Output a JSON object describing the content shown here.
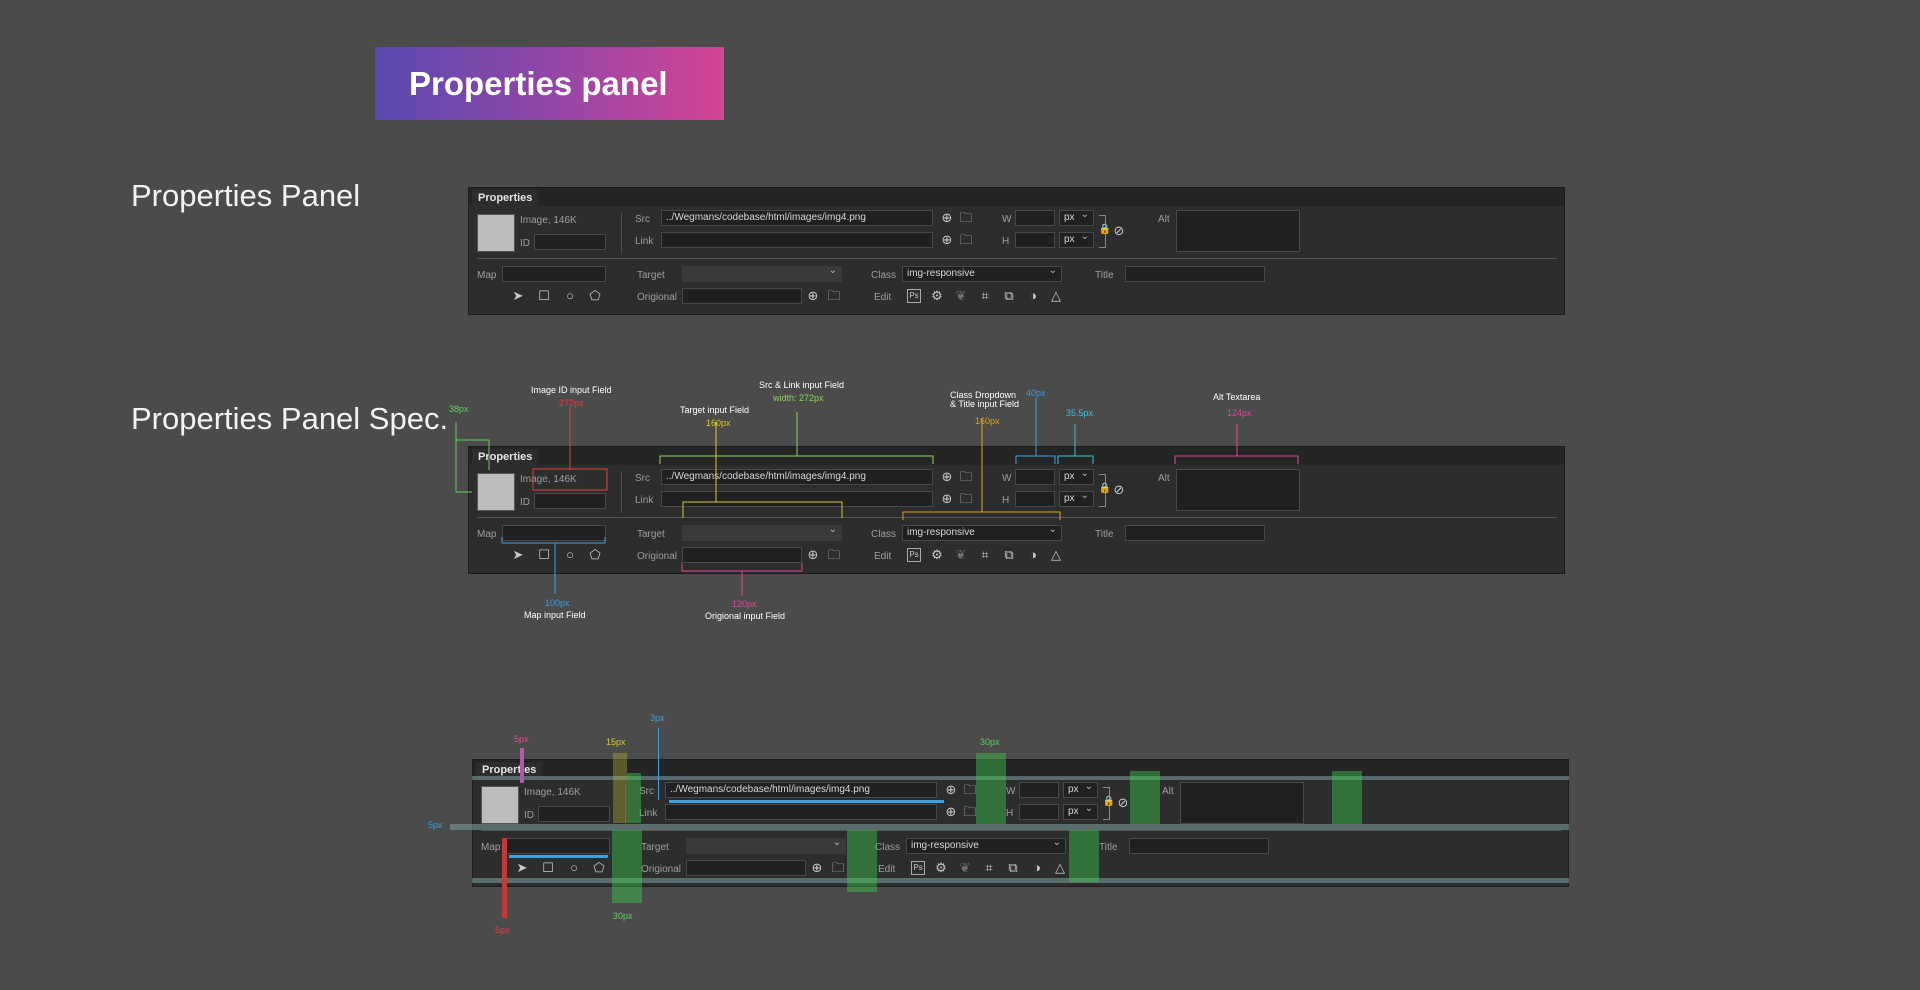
{
  "banner": {
    "title": "Properties panel"
  },
  "sections": {
    "panel": "Properties Panel",
    "spec": "Properties Panel Spec."
  },
  "panel": {
    "tab": "Properties",
    "image_info": "Image, 146K",
    "id_label": "ID",
    "src_label": "Src",
    "src_value": "../Wegmans/codebase/html/images/img4.png",
    "link_label": "Link",
    "w_label": "W",
    "h_label": "H",
    "unit": "px",
    "alt_label": "Alt",
    "map_label": "Map",
    "target_label": "Target",
    "original_label": "Origional",
    "class_label": "Class",
    "class_value": "img-responsive",
    "title_label": "Title",
    "edit_label": "Edit",
    "ps_label": "Ps",
    "icons": [
      "crosshair-icon",
      "folder-icon",
      "lock-icon",
      "no-icon",
      "pointer-icon",
      "rect-hotspot-icon",
      "circle-hotspot-icon",
      "polygon-hotspot-icon",
      "gear-icon",
      "optimize-icon",
      "crop-icon",
      "resample-icon",
      "brightness-icon",
      "sharpen-icon"
    ]
  },
  "spec_annotations": {
    "thumb_size": "38px",
    "image_id_title": "Image ID input Field",
    "image_id_size": "272px",
    "target_title": "Target input Field",
    "target_size": "160px",
    "src_link_title": "Src & Link input Field",
    "src_link_size": "width: 272px",
    "class_title_line1": "Class Dropdown",
    "class_title_line2": "& Title input Field",
    "class_title_size": "160px",
    "wh_size": "40px",
    "unit_size": "35.5px",
    "alt_title": "Alt Textarea",
    "alt_size": "124px",
    "map_size": "100px",
    "map_title": "Map input Field",
    "original_size": "120px",
    "original_title": "Origional input Field"
  },
  "spacing_annotations": {
    "gap_5a": "5px",
    "gap_15": "15px",
    "gap_3": "3px",
    "gap_30a": "30px",
    "row_gap": "5px",
    "gap_30b": "30px",
    "gap_5b": "5px"
  }
}
